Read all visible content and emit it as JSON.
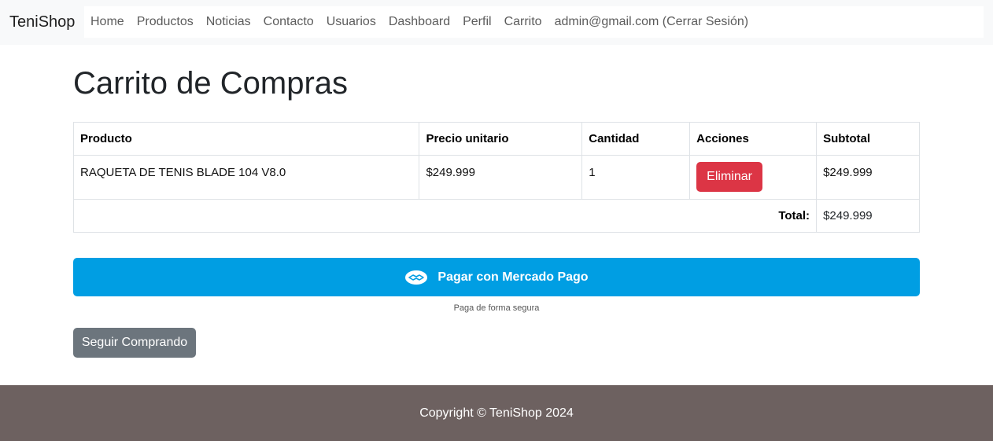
{
  "navbar": {
    "brand": "TeniShop",
    "links": [
      "Home",
      "Productos",
      "Noticias",
      "Contacto",
      "Usuarios",
      "Dashboard",
      "Perfil",
      "Carrito",
      "admin@gmail.com (Cerrar Sesión)"
    ]
  },
  "page": {
    "title": "Carrito de Compras"
  },
  "cart_table": {
    "headers": [
      "Producto",
      "Precio unitario",
      "Cantidad",
      "Acciones",
      "Subtotal"
    ],
    "rows": [
      {
        "product": "RAQUETA DE TENIS BLADE 104 V8.0",
        "unit_price": "$249.999",
        "quantity": "1",
        "action_label": "Eliminar",
        "subtotal": "$249.999"
      }
    ],
    "total_label": "Total:",
    "total_value": "$249.999"
  },
  "payment": {
    "button_label": "Pagar con Mercado Pago",
    "icon": "handshake-icon",
    "secure_note": "Paga de forma segura"
  },
  "continue_button": "Seguir Comprando",
  "footer": {
    "copyright": "Copyright © TeniShop 2024"
  },
  "colors": {
    "mercado_pago_blue": "#009ee3",
    "danger": "#dc3545",
    "secondary": "#6c757d",
    "footer_bg": "#6d6160"
  }
}
